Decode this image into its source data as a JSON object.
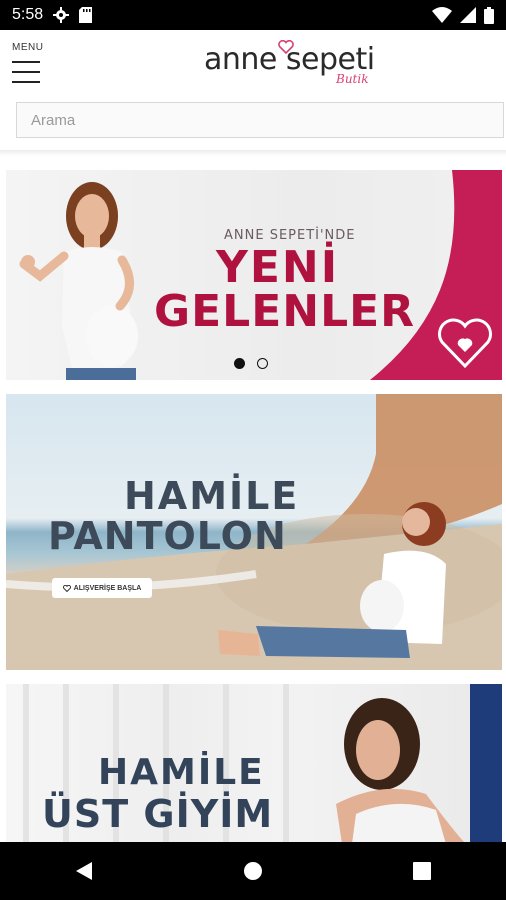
{
  "status_bar": {
    "time": "5:58",
    "icons": [
      "gear-icon",
      "sd-card-icon",
      "wifi-icon",
      "signal-icon",
      "battery-icon"
    ]
  },
  "header": {
    "menu_label": "MENU",
    "logo_text": "anne sepeti",
    "logo_sub": "Butik"
  },
  "search": {
    "placeholder": "Arama"
  },
  "banners": [
    {
      "small": "ANNE SEPETİ'NDE",
      "line1": "YENİ",
      "line2": "GELENLER",
      "slides": 2,
      "active_slide": 1
    },
    {
      "line1": "HAMİLE",
      "line2": "PANTOLON",
      "button": "ALIŞVERİŞE BAŞLA"
    },
    {
      "line1": "HAMİLE",
      "line2": "ÜST GİYİM"
    }
  ],
  "colors": {
    "accent": "#b0123f",
    "pink_panel": "#c51d55",
    "title_dark": "#3d4a5a"
  },
  "navbar": {
    "icons": [
      "back-icon",
      "home-icon",
      "recents-icon"
    ]
  }
}
